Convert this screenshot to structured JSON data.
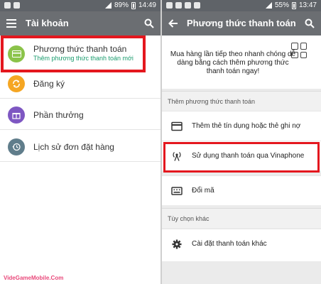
{
  "left": {
    "status": {
      "battery": "89%",
      "time": "14:49"
    },
    "appbar": {
      "title": "Tài khoản"
    },
    "menu": [
      {
        "label": "Phương thức thanh toán",
        "sublabel": "Thêm phương thức thanh toán mới",
        "icon": "card-icon",
        "color": "#8bc34a"
      },
      {
        "label": "Đăng ký",
        "icon": "refresh-icon",
        "color": "#f5a623"
      },
      {
        "label": "Phần thưởng",
        "icon": "gift-icon",
        "color": "#7e57c2"
      },
      {
        "label": "Lịch sử đơn đặt hàng",
        "icon": "history-icon",
        "color": "#607d8b"
      }
    ]
  },
  "right": {
    "status": {
      "battery": "55%",
      "time": "13:47"
    },
    "appbar": {
      "title": "Phương thức thanh toán"
    },
    "hero_message": "Mua hàng lần tiếp theo nhanh chóng dễ dàng bằng cách thêm phương thức thanh toán ngay!",
    "section_add": "Thêm phương thức thanh toán",
    "add_options": [
      {
        "label": "Thêm thẻ tín dụng hoặc thẻ ghi nợ",
        "icon": "credit-card-icon"
      },
      {
        "label": "Sử dụng thanh toán qua Vinaphone",
        "icon": "antenna-icon"
      },
      {
        "label": "Đổi mã",
        "icon": "keyboard-icon"
      }
    ],
    "section_other": "Tùy chọn khác",
    "other_options": [
      {
        "label": "Cài đặt thanh toán khác",
        "icon": "gear-icon"
      }
    ]
  },
  "watermark": "VideGameMobile.Com",
  "colors": {
    "appbar": "#6b6e72",
    "highlight": "#e4171e",
    "sublabel": "#1a9c6e"
  }
}
